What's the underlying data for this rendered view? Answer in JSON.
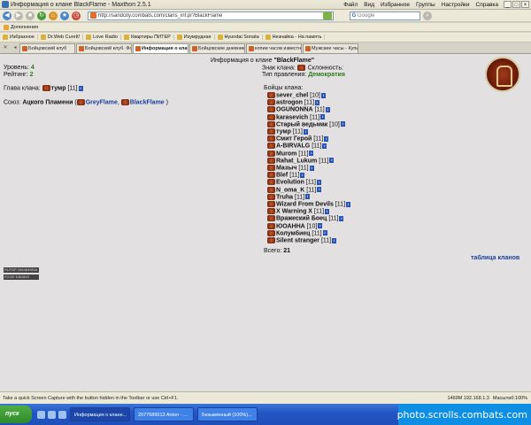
{
  "window": {
    "title": "Информация о клане BlackFlame - Maxthon 2.5.1",
    "menu": [
      "Файл",
      "Вид",
      "Избранное",
      "Группы",
      "Настройки",
      "Справка"
    ]
  },
  "nav": {
    "url": "http://sandcity.combats.com/clans_inf.pl?BlackFlame",
    "search_placeholder": "Google"
  },
  "links_bar": [
    "Дополнения"
  ],
  "favorites": [
    "Избранное",
    "Dr.Web CureIt!",
    "Love Radio",
    "Квартиры ПИТЕР",
    "Изумрудная",
    "Hyundai Sonata",
    "Незнайка - На память"
  ],
  "tabs": [
    "Бойцовский клуб",
    "Бойцовский клуб. Форум: \"Пер...",
    "Информация о клане BlackF...",
    "Бойцовские дневники - Ворлок...",
    "копии часов известных марок ...",
    "Мужские часы - Купить копии - ст..."
  ],
  "page": {
    "header_label": "Информация о клане",
    "clan_name": "\"BlackFlame\"",
    "level_label": "Уровень:",
    "level_value": "4",
    "rating_label": "Рейтинг:",
    "rating_value": "2",
    "sign_label": "Знак клана:",
    "alignment_label": "Склонность:",
    "govt_label": "Тип правления:",
    "govt_value": "Демократия",
    "head_label": "Глава клана:",
    "head_name": "тумр",
    "head_level": "[11]",
    "union_label": "Союз:",
    "union_name": "Ацкого Пламени",
    "union_open": "(",
    "union_clan1": "GreyFlame",
    "union_comma": ",",
    "union_clan2": "BlackFlame",
    "union_close": ")",
    "fighters_label": "Бойцы клана:",
    "members": [
      {
        "name": "sever_chel",
        "level": "[10]"
      },
      {
        "name": "astrogon",
        "level": "[11]"
      },
      {
        "name": "OGUNONNA",
        "level": "[11]"
      },
      {
        "name": "karasevich",
        "level": "[11]"
      },
      {
        "name": "Старый ведьмак",
        "level": "[10]"
      },
      {
        "name": "тумр",
        "level": "[11]"
      },
      {
        "name": "Смит Герой",
        "level": "[11]"
      },
      {
        "name": "A-BIRVALG",
        "level": "[11]"
      },
      {
        "name": "Murom",
        "level": "[11]"
      },
      {
        "name": "Rahat_Lukum",
        "level": "[11]"
      },
      {
        "name": "Мазыч",
        "level": "[11]"
      },
      {
        "name": "Blef",
        "level": "[11]"
      },
      {
        "name": "Evolution",
        "level": "[11]"
      },
      {
        "name": "N_oma_K",
        "level": "[11]"
      },
      {
        "name": "Truha",
        "level": "[11]"
      },
      {
        "name": "Wizard From Devils",
        "level": "[11]"
      },
      {
        "name": "X Warning X",
        "level": "[11]"
      },
      {
        "name": "Вражеский Боец",
        "level": "[11]"
      },
      {
        "name": "ЮОАННА",
        "level": "[10]"
      },
      {
        "name": "Колумбиец",
        "level": "[11]"
      },
      {
        "name": "Silent stranger",
        "level": "[11]"
      }
    ],
    "total_label": "Всего:",
    "total_value": "21",
    "clans_table_link": "таблица кланов"
  },
  "counters": [
    "RUTOP 2844649516",
    "FCGE 1061810 16102"
  ],
  "statusbar": {
    "message": "Take a quick Screen Capture with the button hidden in the Toolbar or use Ctrl+F1.",
    "right": "1469M 192.168.1.3",
    "zoom": "Масштаб:100%"
  },
  "taskbar": {
    "start_label": "пуск",
    "tasks": [
      "Информация о клане...",
      "2077686013 Anton - ...",
      "Безымянный (100%)..."
    ],
    "watermark": "photo.scrolls.combats.com"
  },
  "colors": {
    "accent_green": "#2e7a1e",
    "link_blue": "#1a3f9a",
    "content_bg": "#e2e0e0"
  }
}
